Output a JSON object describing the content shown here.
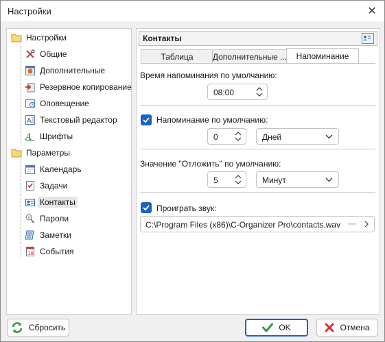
{
  "window": {
    "title": "Настройки"
  },
  "tree": {
    "groups": [
      {
        "label": "Настройки",
        "icon": "folder-icon",
        "items": [
          {
            "label": "Общие",
            "icon": "tools-icon"
          },
          {
            "label": "Дополнительные",
            "icon": "settings-advanced-icon"
          },
          {
            "label": "Резервное копирование",
            "icon": "backup-icon"
          },
          {
            "label": "Оповещение",
            "icon": "notification-icon"
          },
          {
            "label": "Текстовый редактор",
            "icon": "text-editor-icon"
          },
          {
            "label": "Шрифты",
            "icon": "fonts-icon"
          }
        ]
      },
      {
        "label": "Параметры",
        "icon": "folder-icon",
        "items": [
          {
            "label": "Календарь",
            "icon": "calendar-icon"
          },
          {
            "label": "Задачи",
            "icon": "tasks-icon"
          },
          {
            "label": "Контакты",
            "icon": "contacts-icon",
            "selected": true
          },
          {
            "label": "Пароли",
            "icon": "passwords-icon"
          },
          {
            "label": "Заметки",
            "icon": "notes-icon"
          },
          {
            "label": "События",
            "icon": "events-icon"
          }
        ]
      }
    ]
  },
  "panel": {
    "title": "Контакты",
    "tabs": [
      {
        "label": "Таблица"
      },
      {
        "label": "Дополнительные ..."
      },
      {
        "label": "Напоминание",
        "active": true
      }
    ],
    "reminder_time": {
      "label": "Время напоминания по умолчанию:",
      "value": "08:00"
    },
    "default_reminder": {
      "label": "Напоминание по умолчанию:",
      "checked": true,
      "value": "0",
      "unit": "Дней"
    },
    "snooze": {
      "label": "Значение \"Отложить\" по умолчанию:",
      "value": "5",
      "unit": "Минут"
    },
    "sound": {
      "label": "Проиграть звук:",
      "checked": true,
      "path": "C:\\Program Files (x86)\\C-Organizer Pro\\contacts.wav",
      "browse": "···"
    }
  },
  "buttons": {
    "reset": "Сбросить",
    "ok": "OK",
    "cancel": "Отмена"
  },
  "colors": {
    "accent": "#1a63c2",
    "folder": "#f2c04a"
  }
}
